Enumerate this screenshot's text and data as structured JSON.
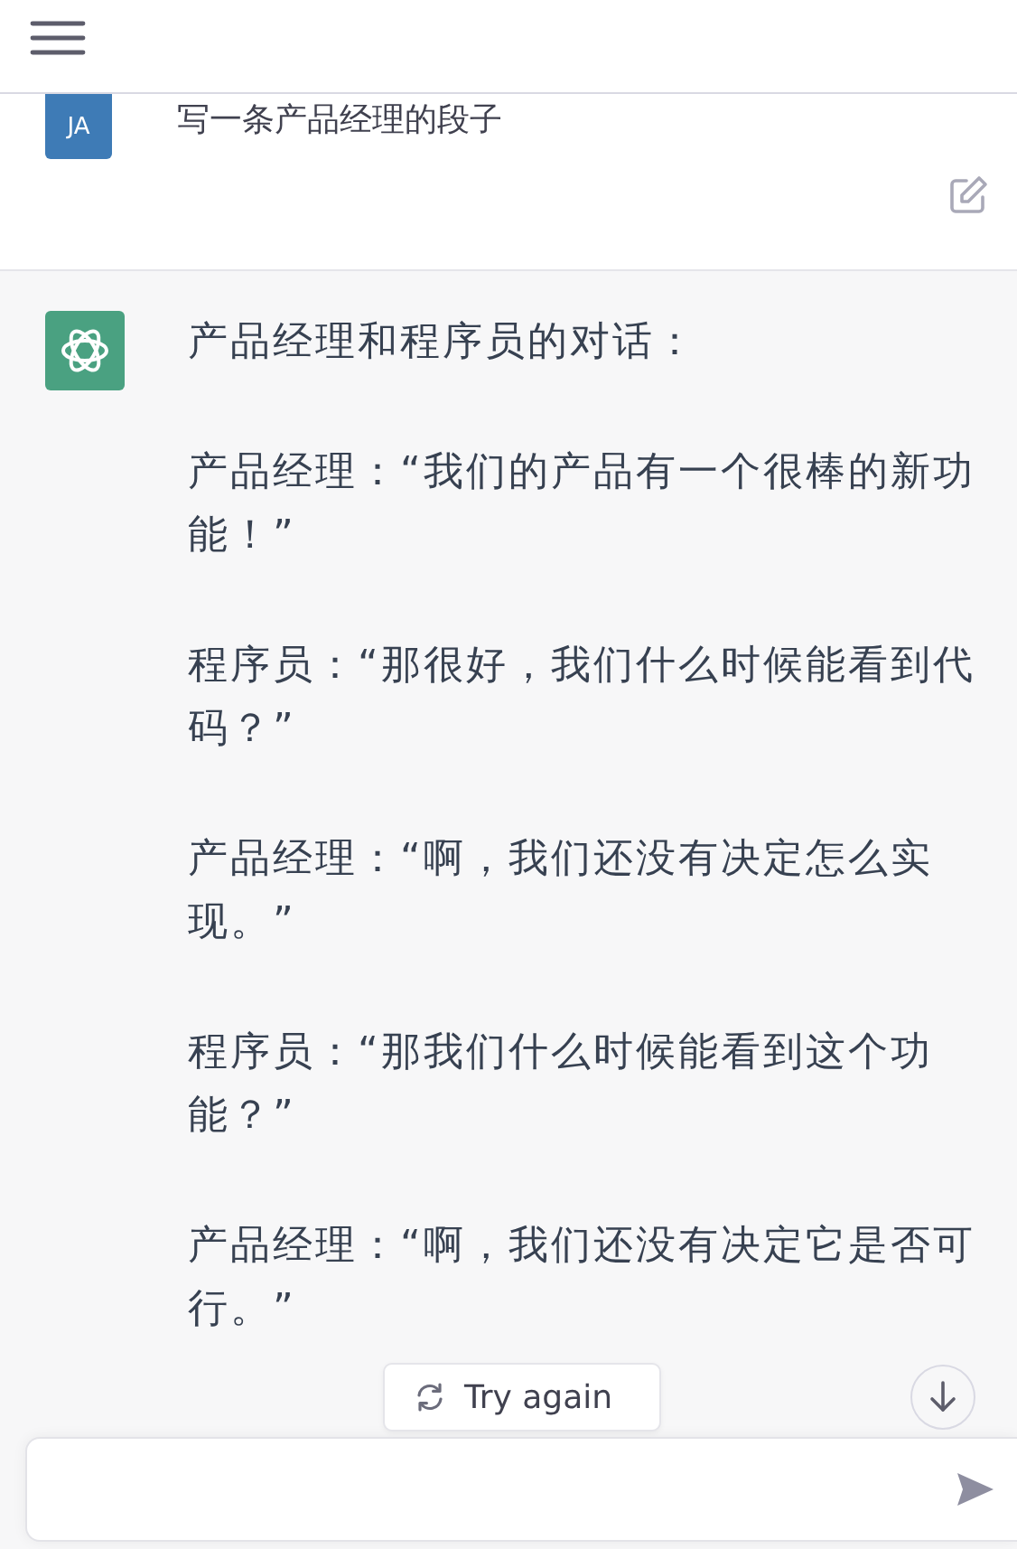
{
  "conversation": [
    {
      "kind": "user",
      "avatar": "JA",
      "text": "写一条产品经理的段子"
    },
    {
      "kind": "assistant",
      "paragraphs": [
        "产品经理和程序员的对话：",
        "产品经理：“我们的产品有一个很棒的新功能！”",
        "程序员：“那很好，我们什么时候能看到代码？”",
        "产品经理：“啊，我们还没有决定怎么实现。”",
        "程序员：“那我们什么时候能看到这个功能？”",
        "产品经理：“啊，我们还没有决定它是否可行。”"
      ]
    }
  ],
  "try_again_button": "Try again"
}
